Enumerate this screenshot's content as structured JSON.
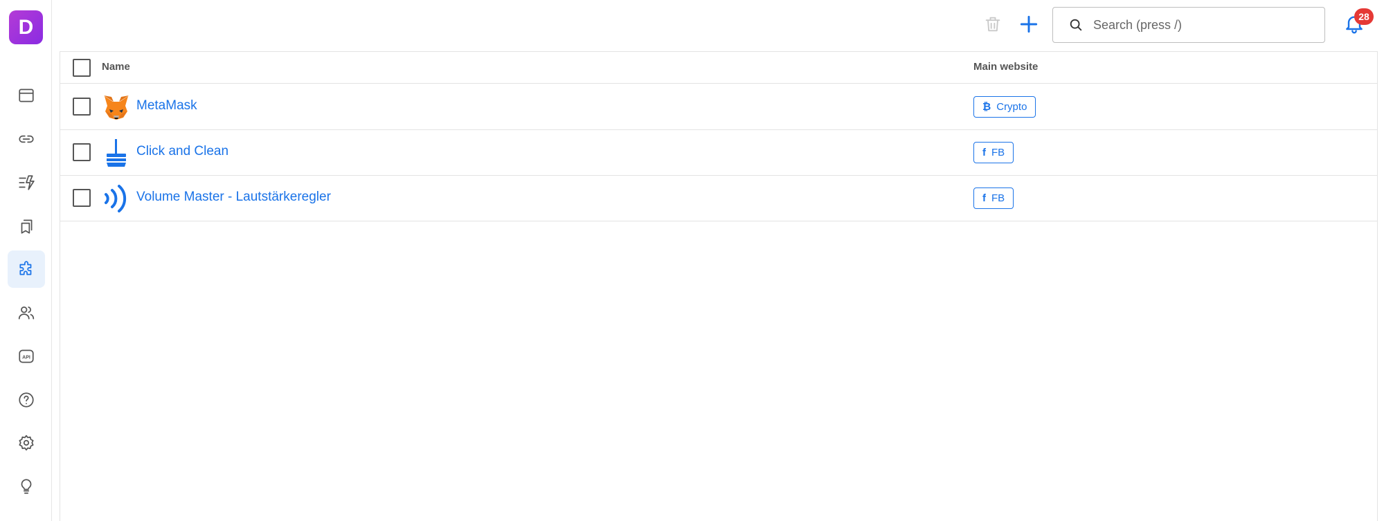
{
  "sidebar": {
    "logo_letter": "D",
    "items": [
      {
        "icon": "browser-window-icon",
        "active": false
      },
      {
        "icon": "link-icon",
        "active": false
      },
      {
        "icon": "automation-icon",
        "active": false
      },
      {
        "icon": "bookmarks-icon",
        "active": false
      },
      {
        "icon": "extension-puzzle-icon",
        "active": true
      },
      {
        "icon": "users-icon",
        "active": false
      },
      {
        "icon": "api-icon",
        "active": false
      },
      {
        "icon": "help-icon",
        "active": false
      },
      {
        "icon": "settings-icon",
        "active": false
      },
      {
        "icon": "lightbulb-icon",
        "active": false
      }
    ]
  },
  "header": {
    "search_placeholder": "Search (press /)",
    "notification_count": "28"
  },
  "table": {
    "columns": {
      "name": "Name",
      "main_website": "Main website"
    },
    "rows": [
      {
        "name": "MetaMask",
        "icon": "metamask-fox-icon",
        "website": "Crypto",
        "website_icon": "bitcoin-icon",
        "website_glyph": "₿"
      },
      {
        "name": "Click and Clean",
        "icon": "broom-icon",
        "website": "FB",
        "website_icon": "facebook-icon",
        "website_glyph": "f"
      },
      {
        "name": "Volume Master - Lautstärkeregler",
        "icon": "volume-waves-icon",
        "website": "FB",
        "website_icon": "facebook-icon",
        "website_glyph": "f"
      }
    ]
  },
  "colors": {
    "accent": "#1a73e8",
    "badge": "#e53935",
    "logo": "#a134dc"
  }
}
